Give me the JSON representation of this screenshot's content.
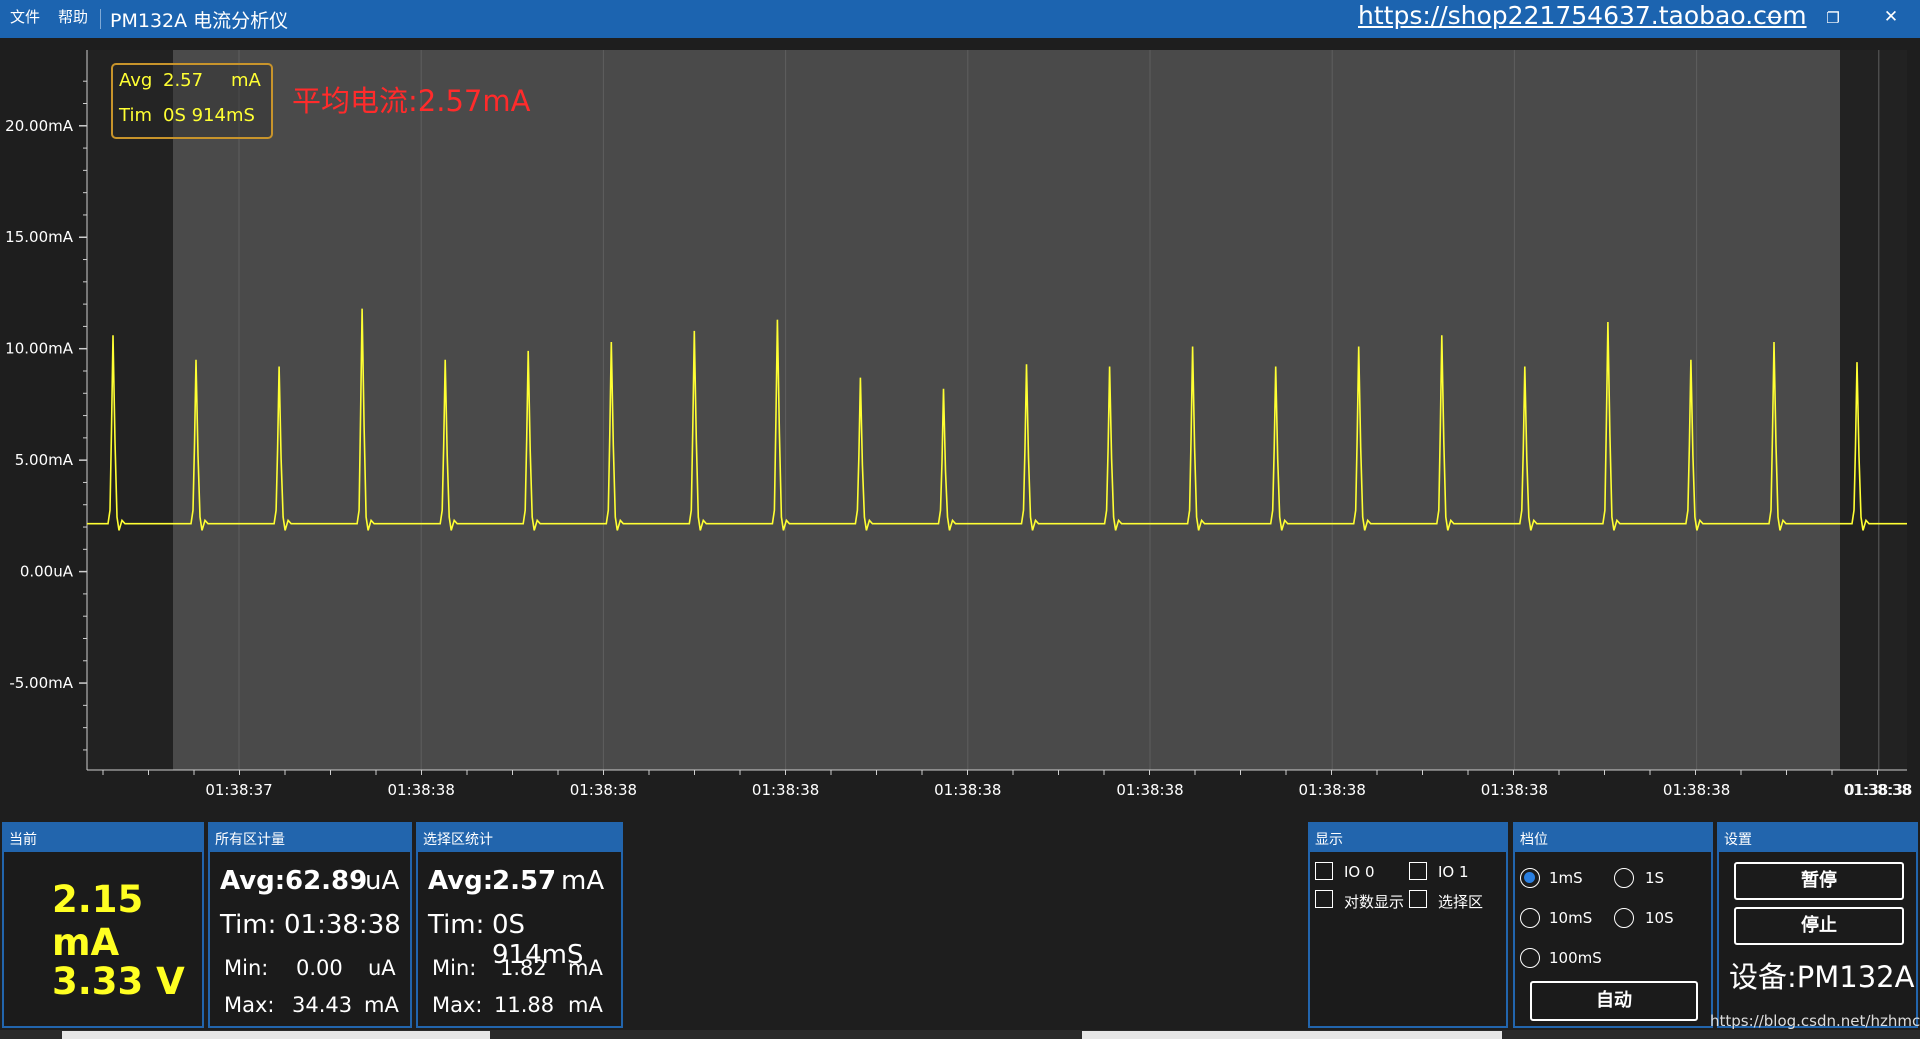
{
  "menu": {
    "file": "文件",
    "help": "帮助"
  },
  "app_title": "PM132A 电流分析仪",
  "link_url": "https://shop221754637.taobao.com",
  "window_controls": [
    "minimize-icon",
    "restore-icon",
    "close-icon"
  ],
  "chart_overlay": {
    "avg_label": "Avg",
    "avg_value": "2.57",
    "avg_unit": "mA",
    "tim_label": "Tim",
    "tim_value": "0S 914mS",
    "average_text": "平均电流:2.57mA"
  },
  "colors": {
    "trace": "#ffff33",
    "accent": "#2265ad",
    "title_bar": "#1c64b0",
    "average_text": "#ff2b2b"
  },
  "chart_data": {
    "type": "line",
    "ylabels": [
      "20.00mA",
      "15.00mA",
      "10.00mA",
      "5.00mA",
      "0.00uA",
      "-5.00mA"
    ],
    "yticks": [
      20,
      15,
      10,
      5,
      0,
      -5
    ],
    "ylim": [
      -8.9,
      23.4
    ],
    "xlabels": [
      "01:38:37",
      "01:38:38",
      "01:38:38",
      "01:38:38",
      "01:38:38",
      "01:38:38",
      "01:38:38",
      "01:38:38",
      "01:38:38",
      "01:38:38"
    ],
    "grid": true,
    "selection_region": "highlighted",
    "series": [
      {
        "unit": "mA",
        "baseline": 2.15,
        "pulse_heights": [
          10.6,
          9.5,
          9.2,
          11.8,
          9.5,
          9.9,
          10.3,
          10.8,
          11.3,
          8.7,
          8.2,
          9.3,
          9.2,
          10.1,
          9.2,
          10.1,
          10.6,
          9.2,
          11.2,
          9.5,
          10.3,
          9.4
        ]
      }
    ]
  },
  "panels": {
    "current": {
      "title": "当前",
      "current_value": "2.15 mA",
      "voltage_value": "3.33 V"
    },
    "all": {
      "title": "所有区计量",
      "avg_label": "Avg:",
      "avg_value": "62.89",
      "avg_unit": "uA",
      "tim_label": "Tim:",
      "tim_value": "01:38:38",
      "min_label": "Min:",
      "min_value": "0.00",
      "min_unit": "uA",
      "max_label": "Max:",
      "max_value": "34.43",
      "max_unit": "mA"
    },
    "selection": {
      "title": "选择区统计",
      "avg_label": "Avg:",
      "avg_value": "2.57",
      "avg_unit": "mA",
      "tim_label": "Tim:",
      "tim_value": "0S 914mS",
      "min_label": "Min:",
      "min_value": "1.82",
      "min_unit": "mA",
      "max_label": "Max:",
      "max_value": "11.88",
      "max_unit": "mA"
    },
    "display": {
      "title": "显示",
      "io0": "IO 0",
      "io1": "IO 1",
      "log": "对数显示",
      "region": "选择区",
      "io0_checked": false,
      "io1_checked": false,
      "log_checked": false,
      "region_checked": false
    },
    "range": {
      "title": "档位",
      "options": [
        "1mS",
        "1S",
        "10mS",
        "10S",
        "100mS"
      ],
      "selected": "1mS",
      "auto_button": "自动"
    },
    "settings": {
      "title": "设置",
      "pause": "暂停",
      "stop": "停止",
      "device": "设备:PM132A"
    }
  },
  "watermark": "https://blog.csdn.net/hzhmcu"
}
